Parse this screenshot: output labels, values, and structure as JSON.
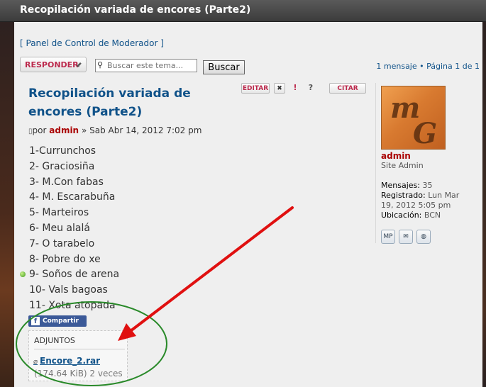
{
  "window": {
    "title": "Recopilación variada de encores (Parte2)"
  },
  "moderator_link": "[ Panel de Control de Moderador ]",
  "toolbar": {
    "reply_label": "RESPONDER",
    "search_placeholder": "Buscar este tema...",
    "search_button": "Buscar",
    "pagination": "1 mensaje • Página 1 de 1"
  },
  "post": {
    "title": "Recopilación variada de encores (Parte2)",
    "by_prefix": "por",
    "author": "admin",
    "date": "» Sab Abr 14, 2012 7:02 pm",
    "actions": {
      "edit": "EDITAR",
      "delete": "✖",
      "report": "!",
      "info": "?",
      "quote": "CITAR"
    },
    "tracks": [
      "1-Currunchos",
      "2- Graciosiña",
      "3- M.Con fabas",
      "4- M. Escarabuña",
      "5- Marteiros",
      "6- Meu alalá",
      "7- O tarabelo",
      "8- Pobre do xe",
      "9- Soños de arena",
      "10- Vals bagoas",
      "11- Xota atopada"
    ],
    "share_label": "Compartir",
    "attachments": {
      "heading": "ADJUNTOS",
      "file_name": "Encore_2.rar",
      "file_meta": "(174.64 KiB) 2 veces"
    }
  },
  "profile": {
    "name": "admin",
    "rank": "Site Admin",
    "posts_label": "Mensajes:",
    "posts_value": "35",
    "registered_label": "Registrado:",
    "registered_value": "Lun Mar 19, 2012 5:05 pm",
    "location_label": "Ubicación:",
    "location_value": "BCN",
    "pm_icon_text": "MP"
  },
  "colors": {
    "link": "#105289",
    "accent_red": "#bc2a4d",
    "annotation_arrow": "#e01010",
    "annotation_circle": "#2a8a2a"
  }
}
